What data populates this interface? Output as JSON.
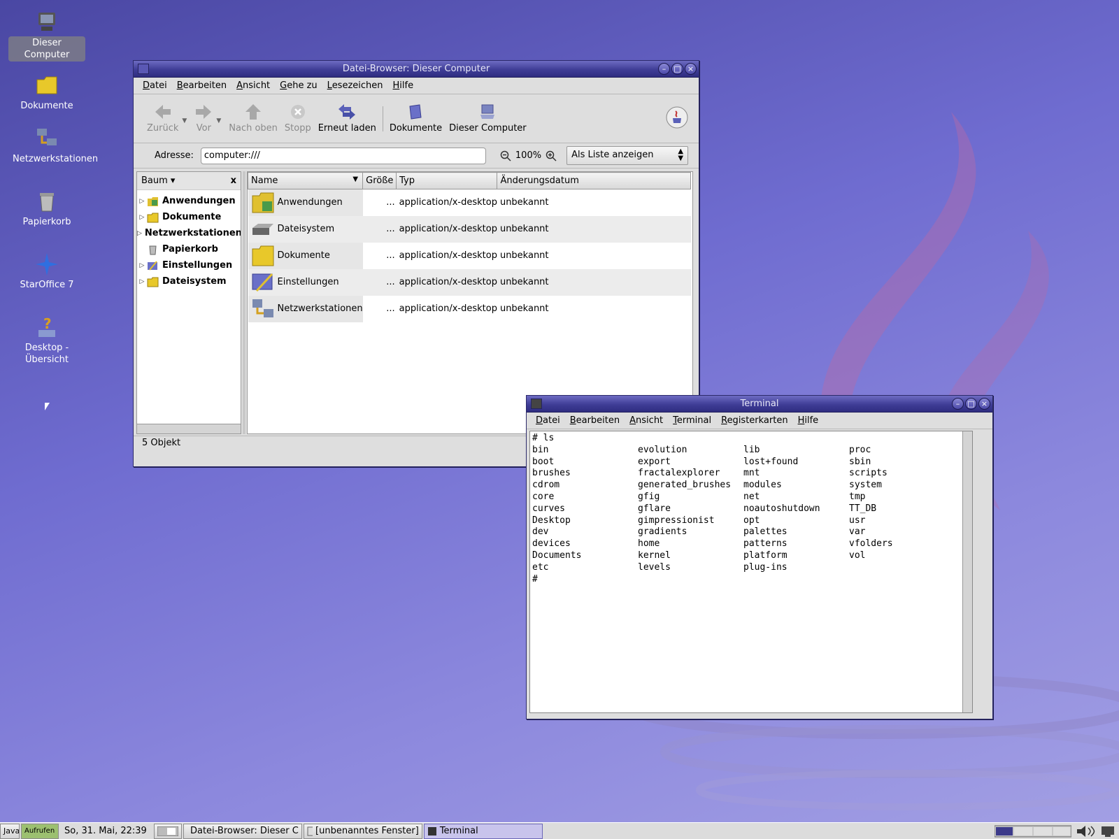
{
  "desktop": {
    "icons": [
      {
        "label": "Dieser Computer",
        "icon": "computer-icon"
      },
      {
        "label": "Dokumente",
        "icon": "folder-icon"
      },
      {
        "label": "Netzwerkstationen",
        "icon": "network-icon"
      },
      {
        "label": "Papierkorb",
        "icon": "trash-icon"
      },
      {
        "label": "StarOffice 7",
        "icon": "staroffice-icon"
      },
      {
        "label": "Desktop - Übersicht",
        "icon": "help-icon"
      }
    ]
  },
  "filebrowser": {
    "title": "Datei-Browser: Dieser Computer",
    "menu": [
      "Datei",
      "Bearbeiten",
      "Ansicht",
      "Gehe zu",
      "Lesezeichen",
      "Hilfe"
    ],
    "toolbar": {
      "back": "Zurück",
      "forward": "Vor",
      "up": "Nach oben",
      "stop": "Stopp",
      "reload": "Erneut laden",
      "documents": "Dokumente",
      "computer": "Dieser Computer"
    },
    "address_label": "Adresse:",
    "address_value": "computer:///",
    "zoom": "100%",
    "view_mode": "Als Liste anzeigen",
    "side_pane_title": "Baum",
    "side_close": "x",
    "tree": [
      {
        "label": "Anwendungen",
        "expandable": true
      },
      {
        "label": "Dokumente",
        "expandable": true
      },
      {
        "label": "Netzwerkstationen",
        "expandable": true
      },
      {
        "label": "Papierkorb",
        "expandable": false
      },
      {
        "label": "Einstellungen",
        "expandable": true
      },
      {
        "label": "Dateisystem",
        "expandable": true
      }
    ],
    "columns": [
      "Name",
      "Größe",
      "Typ",
      "Änderungsdatum"
    ],
    "files": [
      {
        "name": "Anwendungen",
        "size": "...",
        "type": "application/x-desktop",
        "date": "unbekannt"
      },
      {
        "name": "Dateisystem",
        "size": "...",
        "type": "application/x-desktop",
        "date": "unbekannt"
      },
      {
        "name": "Dokumente",
        "size": "...",
        "type": "application/x-desktop",
        "date": "unbekannt"
      },
      {
        "name": "Einstellungen",
        "size": "...",
        "type": "application/x-desktop",
        "date": "unbekannt"
      },
      {
        "name": "Netzwerkstationen",
        "size": "...",
        "type": "application/x-desktop",
        "date": "unbekannt"
      }
    ],
    "status": "5 Objekt"
  },
  "terminal": {
    "title": "Terminal",
    "menu": [
      "Datei",
      "Bearbeiten",
      "Ansicht",
      "Terminal",
      "Registerkarten",
      "Hilfe"
    ],
    "command": "# ls",
    "listing": [
      "bin",
      "evolution",
      "lib",
      "proc",
      "boot",
      "export",
      "lost+found",
      "sbin",
      "brushes",
      "fractalexplorer",
      "mnt",
      "scripts",
      "cdrom",
      "generated_brushes",
      "modules",
      "system",
      "core",
      "gfig",
      "net",
      "tmp",
      "curves",
      "gflare",
      "noautoshutdown",
      "TT_DB",
      "Desktop",
      "gimpressionist",
      "opt",
      "usr",
      "dev",
      "gradients",
      "palettes",
      "var",
      "devices",
      "home",
      "patterns",
      "vfolders",
      "Documents",
      "kernel",
      "platform",
      "vol",
      "etc",
      "levels",
      "plug-ins",
      ""
    ],
    "prompt": "#"
  },
  "taskbar": {
    "java": "Java",
    "launch": "Aufrufen",
    "clock": "So, 31. Mai, 22:39",
    "tasks": [
      {
        "label": "Datei-Browser: Dieser C"
      },
      {
        "label": "[unbenanntes Fenster]"
      },
      {
        "label": "Terminal"
      }
    ]
  },
  "colors": {
    "desktop_top": "#4a47a3",
    "desktop_bottom": "#a3a0e4",
    "titlebar": "#3f3d96",
    "java_swirl": "#b46aa8"
  }
}
